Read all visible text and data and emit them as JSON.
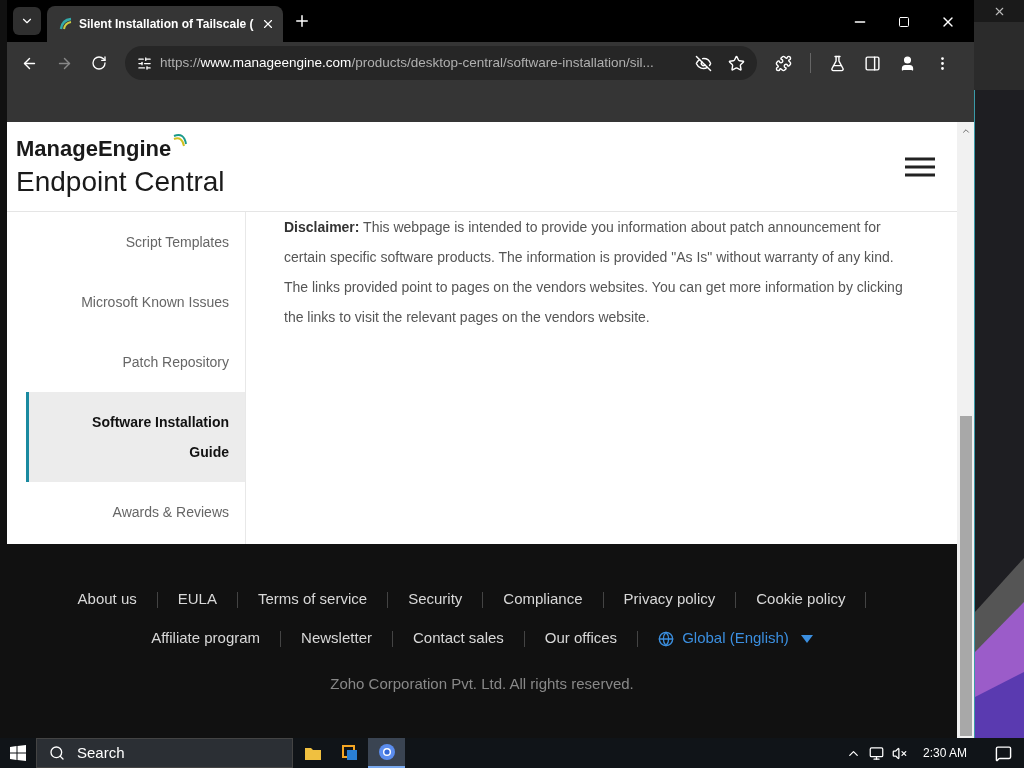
{
  "browser": {
    "tab_title": "Silent Installation of Tailscale (",
    "url": {
      "scheme": "https://",
      "host": "www.manageengine.com",
      "path": "/products/desktop-central/software-installation/sil..."
    }
  },
  "page": {
    "brand": "ManageEngine",
    "product": "Endpoint Central",
    "sidebar": [
      {
        "label": "Script Templates",
        "selected": false
      },
      {
        "label": "Microsoft Known Issues",
        "selected": false
      },
      {
        "label": "Patch Repository",
        "selected": false
      },
      {
        "label": "Software Installation Guide",
        "selected": true
      },
      {
        "label": "Awards & Reviews",
        "selected": false
      }
    ],
    "disclaimer": "**Disclaimer:** This webpage is intended to provide you information about patch announcement for certain specific software products. The information is provided \"As Is\" without warranty of any kind. The links provided point to pages on the vendors websites. You can get more information by clicking the links to visit the relevant pages on the vendors website.",
    "footer": {
      "links": [
        "About us",
        "EULA",
        "Terms of service",
        "Security",
        "Compliance",
        "Privacy policy",
        "Cookie policy",
        "Affiliate program",
        "Newsletter",
        "Contact sales",
        "Our offices"
      ],
      "language": "Global (English)",
      "copyright": "Zoho Corporation Pvt. Ltd. All rights reserved."
    }
  },
  "taskbar": {
    "search": "Search",
    "apps": [
      {
        "kind": "folder",
        "selected": false
      },
      {
        "kind": "windows",
        "selected": false
      },
      {
        "kind": "chrome",
        "selected": true
      }
    ],
    "time": "2:30 AM"
  }
}
